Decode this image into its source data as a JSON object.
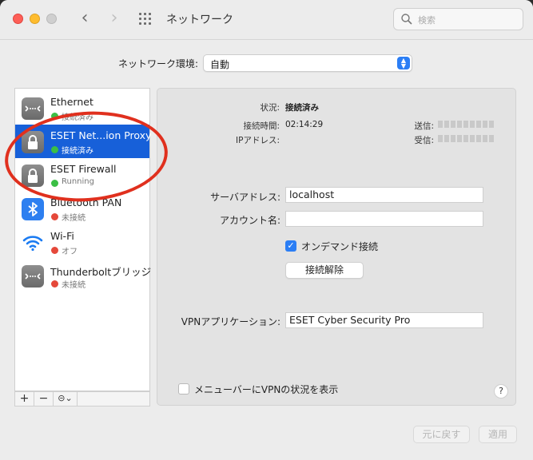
{
  "window": {
    "title": "ネットワーク"
  },
  "search": {
    "placeholder": "検索"
  },
  "location": {
    "label": "ネットワーク環境:",
    "value": "自動"
  },
  "services": [
    {
      "name": "Ethernet",
      "status": "接続済み",
      "status_color": "#3bbf45",
      "icon": "ethernet-icon",
      "selected": false
    },
    {
      "name": "ESET Net...ion Proxy",
      "status": "接続済み",
      "status_color": "#3bbf45",
      "icon": "lock-icon",
      "selected": true
    },
    {
      "name": "ESET Firewall",
      "status": "Running",
      "status_color": "#3bbf45",
      "icon": "lock-icon",
      "selected": false
    },
    {
      "name": "Bluetooth PAN",
      "status": "未接続",
      "status_color": "#e5483a",
      "icon": "bluetooth-icon",
      "selected": false
    },
    {
      "name": "Wi-Fi",
      "status": "オフ",
      "status_color": "#e5483a",
      "icon": "wifi-icon",
      "selected": false
    },
    {
      "name": "Thunderboltブリッジ",
      "status": "未接続",
      "status_color": "#e5483a",
      "icon": "thunderbolt-bridge-icon",
      "selected": false
    }
  ],
  "sidebar_footer": {
    "add": "+",
    "remove": "−",
    "action": "⊝⌄"
  },
  "detail": {
    "status_label": "状況:",
    "status_value": "接続済み",
    "time_label": "接続時間:",
    "time_value": "02:14:29",
    "ip_label": "IPアドレス:",
    "sent_label": "送信:",
    "received_label": "受信:",
    "server_label": "サーバアドレス:",
    "server_value": "localhost",
    "account_label": "アカウント名:",
    "account_value": "",
    "on_demand_label": "オンデマンド接続",
    "on_demand_checked": true,
    "disconnect_button": "接続解除",
    "vpn_app_label": "VPNアプリケーション:",
    "vpn_app_value": "ESET Cyber Security Pro",
    "menubar_label": "メニューバーにVPNの状況を表示",
    "menubar_checked": false,
    "help": "?"
  },
  "footer": {
    "revert": "元に戻す",
    "apply": "適用"
  },
  "colors": {
    "selection": "#1760d9",
    "accent": "#2b7ef5",
    "annotation": "#e0301e"
  }
}
